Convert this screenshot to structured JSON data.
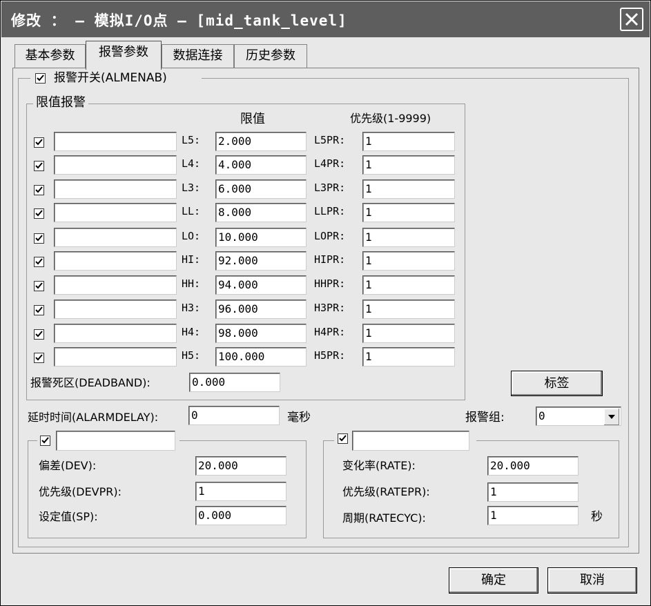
{
  "window": {
    "title": "修改 ： – 模拟I/O点 – [mid_tank_level]"
  },
  "tabs": [
    {
      "label": "基本参数",
      "active": false
    },
    {
      "label": "报警参数",
      "active": true
    },
    {
      "label": "数据连接",
      "active": false
    },
    {
      "label": "历史参数",
      "active": false
    }
  ],
  "alarm_switch": {
    "label": "报警开关(ALMENAB)",
    "checked": true
  },
  "limit_group": {
    "legend": "限值报警",
    "col_limit": "限值",
    "col_priority": "优先级(1-9999)",
    "rows": [
      {
        "checked": true,
        "desc": "",
        "label": "L5:",
        "value": "2.000",
        "pr_label": "L5PR:",
        "priority": "1"
      },
      {
        "checked": true,
        "desc": "",
        "label": "L4:",
        "value": "4.000",
        "pr_label": "L4PR:",
        "priority": "1"
      },
      {
        "checked": true,
        "desc": "",
        "label": "L3:",
        "value": "6.000",
        "pr_label": "L3PR:",
        "priority": "1"
      },
      {
        "checked": true,
        "desc": "",
        "label": "LL:",
        "value": "8.000",
        "pr_label": "LLPR:",
        "priority": "1"
      },
      {
        "checked": true,
        "desc": "",
        "label": "LO:",
        "value": "10.000",
        "pr_label": "LOPR:",
        "priority": "1"
      },
      {
        "checked": true,
        "desc": "",
        "label": "HI:",
        "value": "92.000",
        "pr_label": "HIPR:",
        "priority": "1"
      },
      {
        "checked": true,
        "desc": "",
        "label": "HH:",
        "value": "94.000",
        "pr_label": "HHPR:",
        "priority": "1"
      },
      {
        "checked": true,
        "desc": "",
        "label": "H3:",
        "value": "96.000",
        "pr_label": "H3PR:",
        "priority": "1"
      },
      {
        "checked": true,
        "desc": "",
        "label": "H4:",
        "value": "98.000",
        "pr_label": "H4PR:",
        "priority": "1"
      },
      {
        "checked": true,
        "desc": "",
        "label": "H5:",
        "value": "100.000",
        "pr_label": "H5PR:",
        "priority": "1"
      }
    ],
    "deadband_label": "报警死区(DEADBAND):",
    "deadband_value": "0.000"
  },
  "tag_button": "标签",
  "delay": {
    "label": "延时时间(ALARMDELAY):",
    "value": "0",
    "unit": "毫秒"
  },
  "alarm_group": {
    "label": "报警组:",
    "value": "0"
  },
  "dev_group": {
    "checked": true,
    "desc": "",
    "dev_label": "偏差(DEV):",
    "dev_value": "20.000",
    "pr_label": "优先级(DEVPR):",
    "pr_value": "1",
    "sp_label": "设定值(SP):",
    "sp_value": "0.000"
  },
  "rate_group": {
    "checked": true,
    "desc": "",
    "rate_label": "变化率(RATE):",
    "rate_value": "20.000",
    "pr_label": "优先级(RATEPR):",
    "pr_value": "1",
    "cyc_label": "周期(RATECYC):",
    "cyc_value": "1",
    "cyc_unit": "秒"
  },
  "buttons": {
    "ok": "确定",
    "cancel": "取消"
  }
}
